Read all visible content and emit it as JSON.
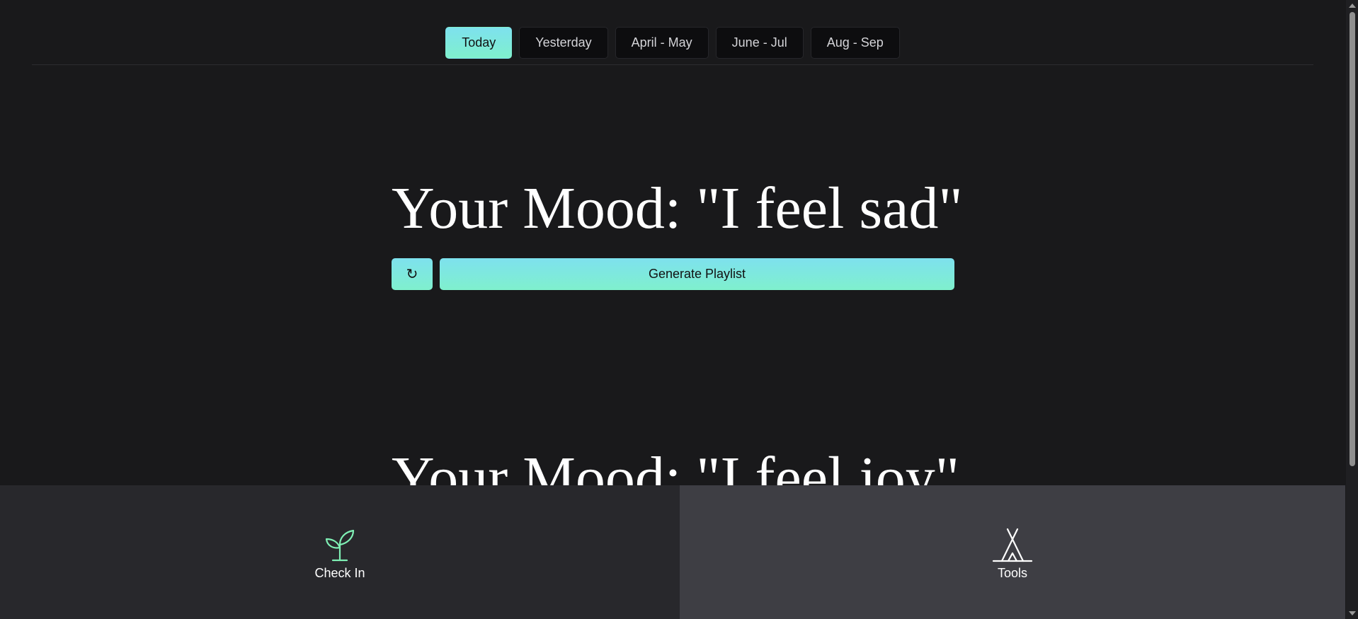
{
  "tabs": [
    {
      "label": "Today",
      "active": true
    },
    {
      "label": "Yesterday",
      "active": false
    },
    {
      "label": "April - May",
      "active": false
    },
    {
      "label": "June - Jul",
      "active": false
    },
    {
      "label": "Aug - Sep",
      "active": false
    }
  ],
  "moods": [
    {
      "title": "Your Mood: \"I feel sad\"",
      "refresh_label": "↻",
      "refresh_icon": "refresh-icon",
      "generate_label": "Generate Playlist"
    },
    {
      "title": "Your Mood: \"I feel joy\""
    }
  ],
  "bottom_nav": [
    {
      "label": "Check In",
      "icon": "sprout-icon",
      "icon_color": "#7ff0b5",
      "active": false
    },
    {
      "label": "Tools",
      "icon": "tent-icon",
      "icon_color": "#ffffff",
      "active": true
    }
  ],
  "colors": {
    "background": "#19191b",
    "accent_gradient_start": "#7ee1ee",
    "accent_gradient_end": "#7ff0cd",
    "nav_background": "#28282c",
    "nav_active_background": "#3e3e44"
  }
}
